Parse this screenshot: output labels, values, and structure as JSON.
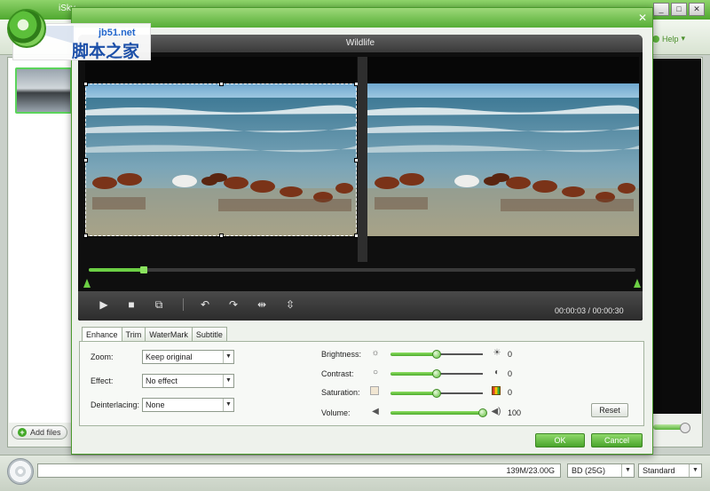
{
  "colors": {
    "accent": "#5fbf3a",
    "dialog_titlebar": "#55ad35",
    "player_bg": "#0f0f0f"
  },
  "main": {
    "title": "iSky",
    "help_label": "Help",
    "add_files_label": "Add files",
    "capacity": "139M/23.00G",
    "disc_type": "BD (25G)",
    "quality": "Standard"
  },
  "watermark": {
    "url": "jb51.net",
    "cn": "脚本之家"
  },
  "dialog": {
    "close_label": "✕",
    "player_title": "Wildlife",
    "time_current": "00:00:03",
    "time_separator": " / ",
    "time_total": "00:00:30",
    "progress": 0.1,
    "tabs": [
      "Enhance",
      "Trim",
      "WaterMark",
      "Subtitle"
    ],
    "active_tab": "Enhance",
    "enhance": {
      "zoom_label": "Zoom:",
      "zoom_value": "Keep original",
      "effect_label": "Effect:",
      "effect_value": "No effect",
      "deinterlacing_label": "Deinterlacing:",
      "deinterlacing_value": "None",
      "brightness_label": "Brightness:",
      "brightness_value": "0",
      "brightness_level": 0.5,
      "contrast_label": "Contrast:",
      "contrast_value": "0",
      "contrast_level": 0.5,
      "saturation_label": "Saturation:",
      "saturation_value": "0",
      "saturation_level": 0.5,
      "volume_label": "Volume:",
      "volume_value": "100",
      "volume_level": 1.0,
      "reset_label": "Reset"
    },
    "ok_label": "OK",
    "cancel_label": "Cancel"
  },
  "icons": {
    "play": "play-icon",
    "stop": "stop-icon",
    "snapshot": "snapshot-icon",
    "rotate_left": "rotate-left-icon",
    "rotate_right": "rotate-right-icon",
    "flip_horizontal": "flip-horizontal-icon",
    "flip_vertical": "flip-vertical-icon"
  }
}
